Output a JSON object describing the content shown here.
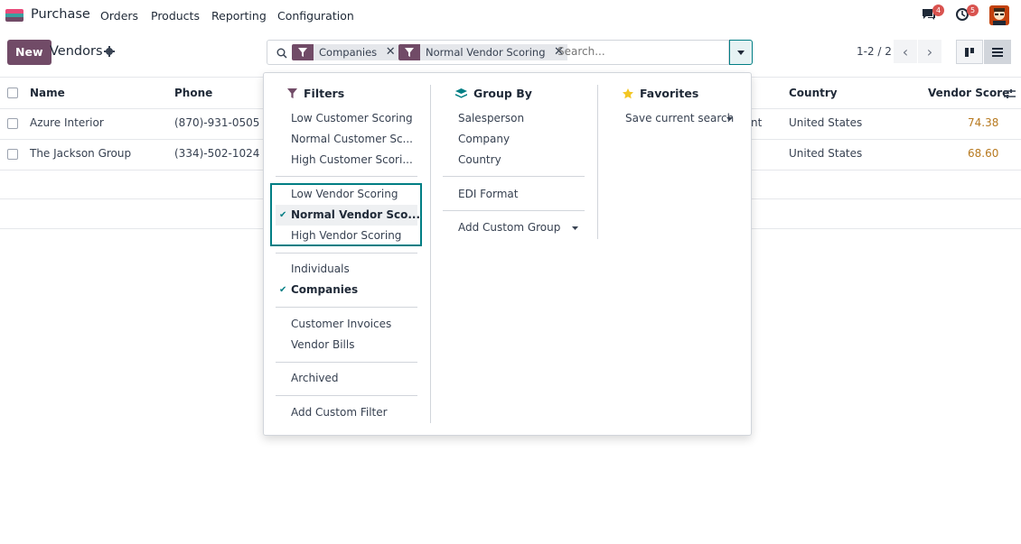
{
  "topbar": {
    "app_name": "Purchase",
    "menu": [
      "Orders",
      "Products",
      "Reporting",
      "Configuration"
    ],
    "messages_badge": "4",
    "activities_badge": "5",
    "logo_colors": [
      "#e84a7a",
      "#3aa0a0",
      "#714b67"
    ]
  },
  "control": {
    "new_label": "New",
    "title": "Vendors",
    "facets": [
      {
        "label": "Companies"
      },
      {
        "label": "Normal Vendor Scoring"
      }
    ],
    "search_placeholder": "Search...",
    "pager": "1-2 / 2"
  },
  "table": {
    "headers": {
      "name": "Name",
      "phone": "Phone",
      "country": "Country",
      "score": "Vendor Score"
    },
    "rows": [
      {
        "name": "Azure Interior",
        "phone": "(870)-931-0505",
        "partial": "nt",
        "country": "United States",
        "score": "74.38"
      },
      {
        "name": "The Jackson Group",
        "phone": "(334)-502-1024",
        "partial": "",
        "country": "United States",
        "score": "68.60"
      }
    ]
  },
  "dropdown": {
    "filters": {
      "title": "Filters",
      "group1": [
        "Low Customer Scoring",
        "Normal Customer Sc...",
        "High Customer Scori..."
      ],
      "group2": [
        "Low Vendor Scoring",
        "Normal Vendor Sco...",
        "High Vendor Scoring"
      ],
      "group3": [
        "Individuals",
        "Companies"
      ],
      "group4": [
        "Customer Invoices",
        "Vendor Bills"
      ],
      "archived": "Archived",
      "add_custom": "Add Custom Filter"
    },
    "group_by": {
      "title": "Group By",
      "items": [
        "Salesperson",
        "Company",
        "Country"
      ],
      "edi": "EDI Format",
      "add_custom": "Add Custom Group"
    },
    "favorites": {
      "title": "Favorites",
      "save": "Save current search"
    }
  },
  "colors": {
    "brand": "#714b67",
    "accent": "#017e84",
    "score": "#b7791f",
    "badge": "#d9534f"
  }
}
